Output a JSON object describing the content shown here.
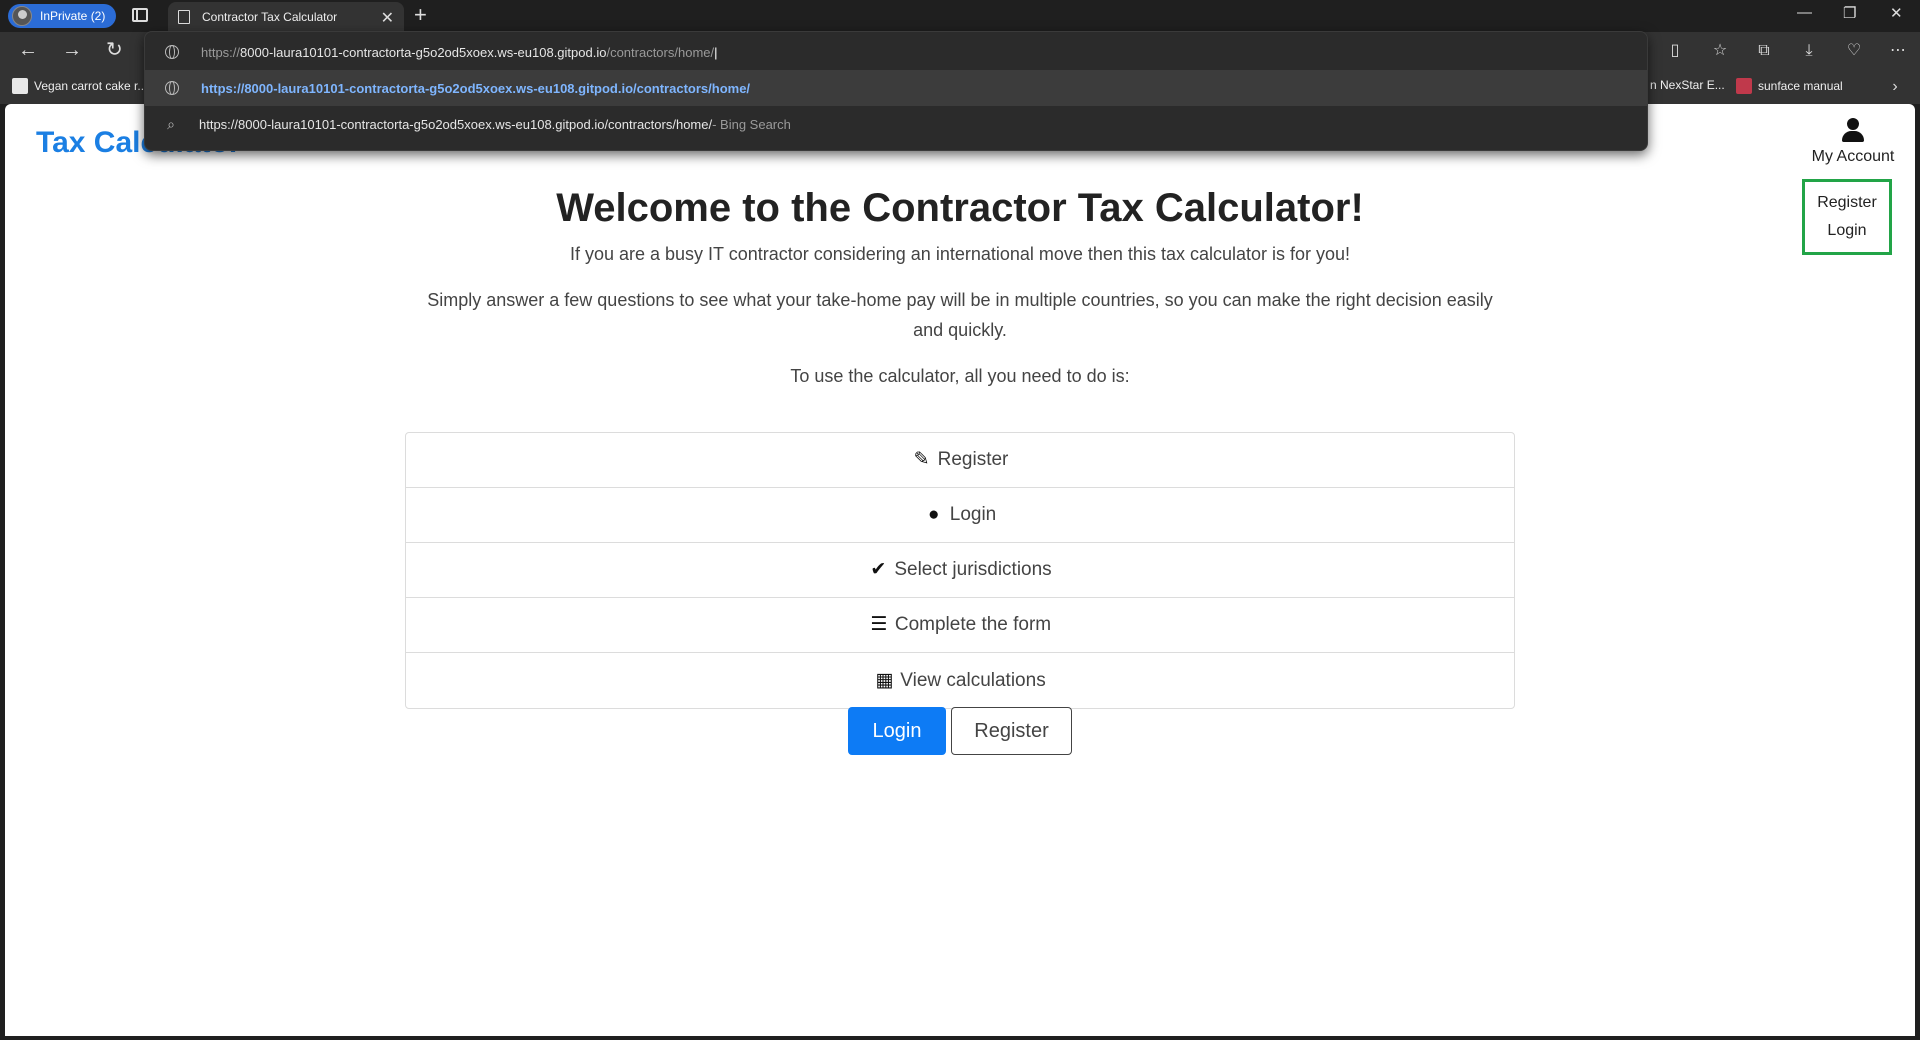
{
  "browser": {
    "profile_label": "InPrivate (2)",
    "tab_title": "Contractor Tax Calculator",
    "new_tab": "+",
    "address_input": {
      "prefix": "https://",
      "host": "8000-laura10101-contractorta-g5o2od5xoex.ws-eu108.gitpod.io",
      "path": "/contractors/home/"
    },
    "suggestions": [
      {
        "text": "https://8000-laura10101-contractorta-g5o2od5xoex.ws-eu108.gitpod.io/contractors/home/",
        "icon": "globe-icon"
      },
      {
        "text": "https://8000-laura10101-contractorta-g5o2od5xoex.ws-eu108.gitpod.io/contractors/home/",
        "suffix": " - Bing Search",
        "icon": "search-icon"
      }
    ],
    "bookmarks": {
      "left": "Vegan carrot cake r...",
      "right1": "n NexStar E...",
      "right2": "sunface manual"
    }
  },
  "page": {
    "brand": "Tax Calculator",
    "account": {
      "label": "My Account",
      "menu": [
        "Register",
        "Login"
      ]
    },
    "heading": "Welcome to the Contractor Tax Calculator!",
    "lead1": "If you are a busy IT contractor considering an international move then this tax calculator is for you!",
    "lead2": "Simply answer a few questions to see what your take-home pay will be in multiple countries, so you can make the right decision easily and quickly.",
    "lead3": "To use the calculator, all you need to do is:",
    "steps": [
      {
        "label": "Register",
        "icon": "edit-icon"
      },
      {
        "label": "Login",
        "icon": "user-icon"
      },
      {
        "label": "Select jurisdictions",
        "icon": "check-double-icon"
      },
      {
        "label": "Complete the form",
        "icon": "list-icon"
      },
      {
        "label": "View calculations",
        "icon": "calculator-icon"
      }
    ],
    "buttons": {
      "login": "Login",
      "register": "Register"
    }
  },
  "colors": {
    "brand": "#1b7fe3",
    "primary": "#0d7bf5",
    "highlight_border": "#22a447"
  }
}
